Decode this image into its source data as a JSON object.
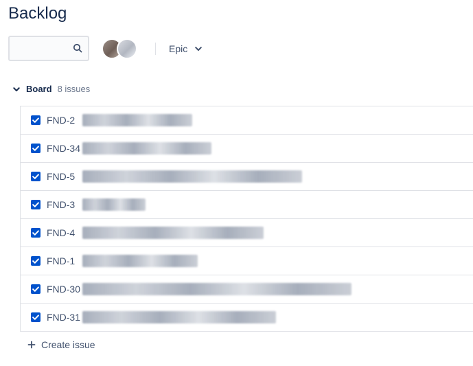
{
  "page": {
    "title": "Backlog"
  },
  "toolbar": {
    "search": {
      "value": "",
      "placeholder": "",
      "icon": "search-icon"
    },
    "epic_label": "Epic"
  },
  "board": {
    "name": "Board",
    "issue_count_text": "8 issues",
    "issues": [
      {
        "key": "FND-2",
        "summary": "",
        "done": true
      },
      {
        "key": "FND-34",
        "summary": "",
        "done": true
      },
      {
        "key": "FND-5",
        "summary": "",
        "done": true
      },
      {
        "key": "FND-3",
        "summary": "",
        "done": true
      },
      {
        "key": "FND-4",
        "summary": "",
        "done": true
      },
      {
        "key": "FND-1",
        "summary": "",
        "done": true
      },
      {
        "key": "FND-30",
        "summary": "",
        "done": true
      },
      {
        "key": "FND-31",
        "summary": "",
        "done": true
      }
    ]
  },
  "create_issue_label": "Create issue",
  "colors": {
    "text_primary": "#172b4d",
    "text_secondary": "#42526e",
    "text_muted": "#6b778c",
    "border": "#dfe1e6",
    "checkbox": "#0052cc"
  }
}
